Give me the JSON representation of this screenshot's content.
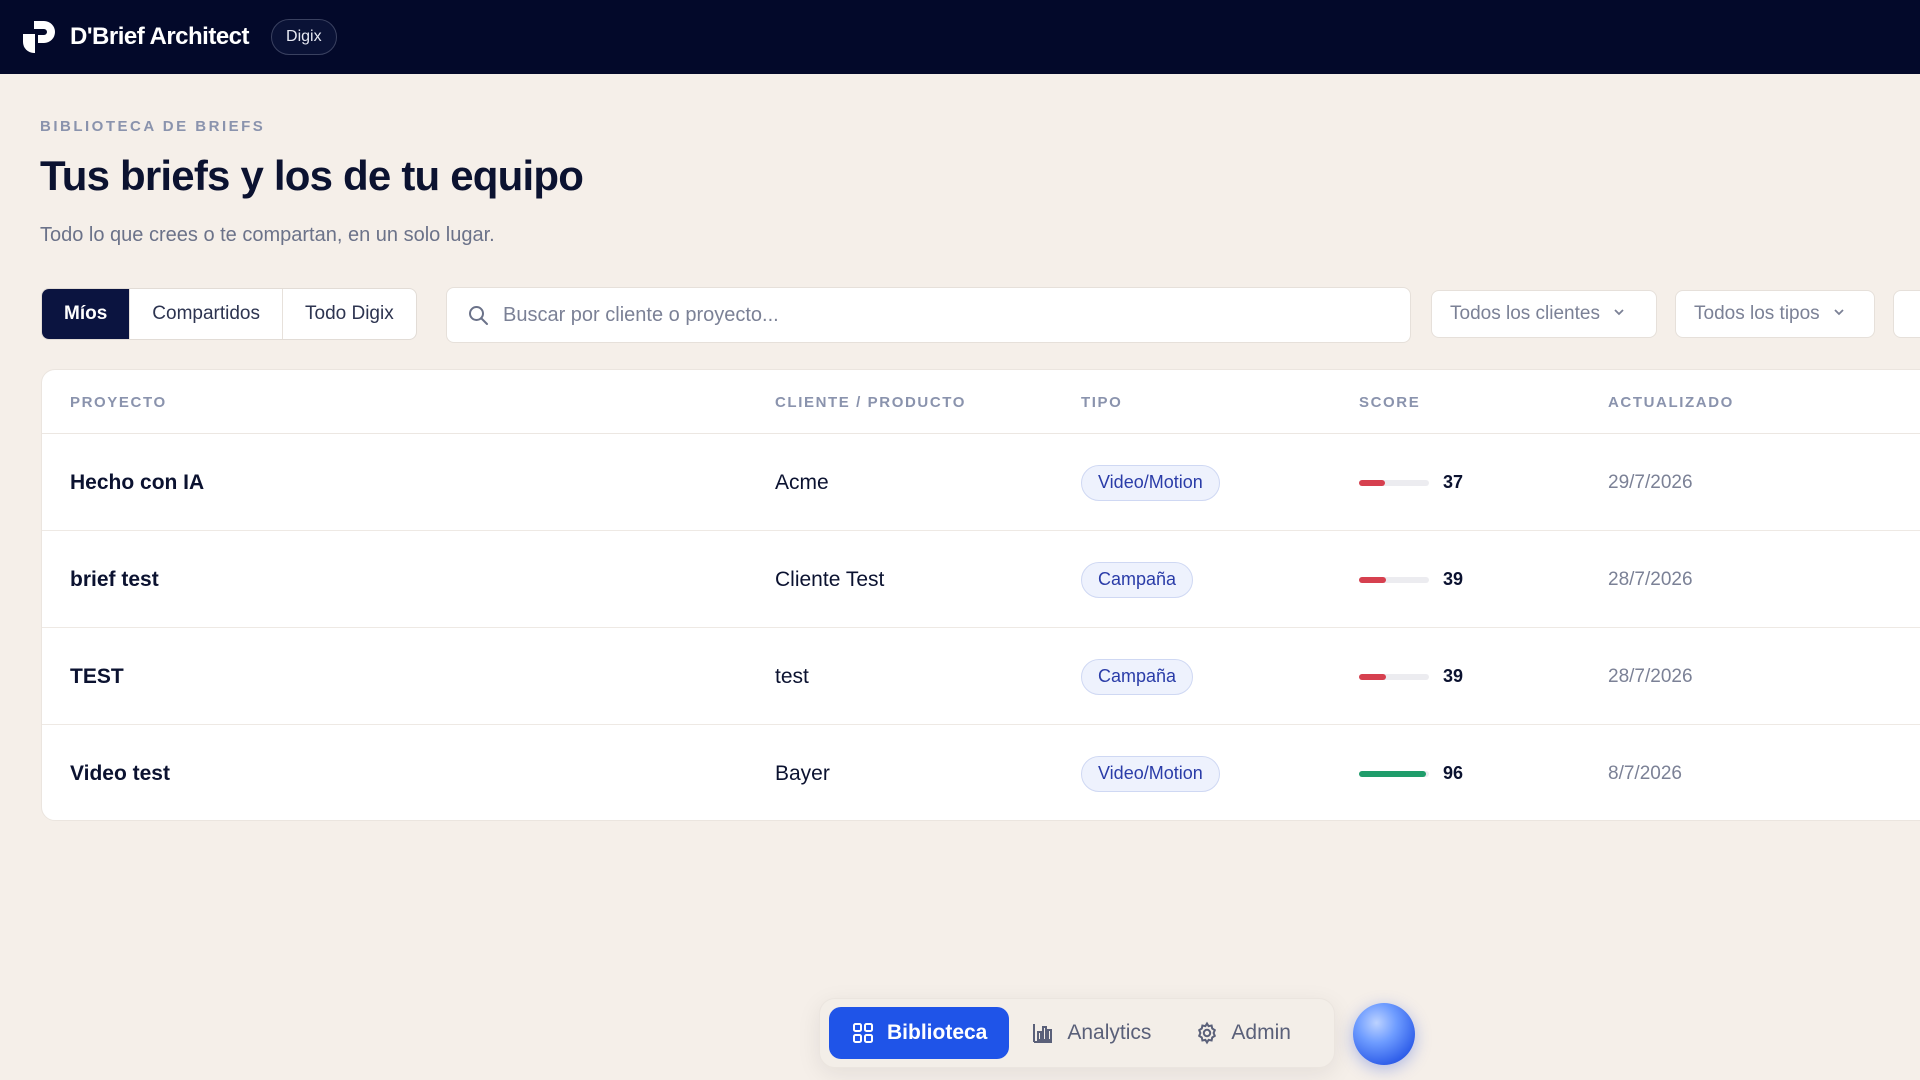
{
  "app": {
    "brand": "D'Brief Architect",
    "org_badge": "Digix"
  },
  "header": {
    "eyebrow": "BIBLIOTECA DE BRIEFS",
    "title": "Tus briefs y los de tu equipo",
    "subtitle": "Todo lo que crees o te compartan, en un solo lugar."
  },
  "filters": {
    "tabs": [
      {
        "label": "Míos",
        "active": true
      },
      {
        "label": "Compartidos",
        "active": false
      },
      {
        "label": "Todo Digix",
        "active": false
      }
    ],
    "search_placeholder": "Buscar por cliente o proyecto...",
    "clients_dropdown": "Todos los clientes",
    "types_dropdown": "Todos los tipos"
  },
  "table": {
    "columns": [
      "PROYECTO",
      "CLIENTE / PRODUCTO",
      "TIPO",
      "SCORE",
      "ACTUALIZADO"
    ],
    "rows": [
      {
        "project": "Hecho con IA",
        "client": "Acme",
        "type": "Video/Motion",
        "score": 37,
        "updated": "29/7/2026"
      },
      {
        "project": "brief test",
        "client": "Cliente Test",
        "type": "Campaña",
        "score": 39,
        "updated": "28/7/2026"
      },
      {
        "project": "TEST",
        "client": "test",
        "type": "Campaña",
        "score": 39,
        "updated": "28/7/2026"
      },
      {
        "project": "Video test",
        "client": "Bayer",
        "type": "Video/Motion",
        "score": 96,
        "updated": "8/7/2026"
      }
    ]
  },
  "dock": {
    "items": [
      {
        "label": "Biblioteca",
        "icon": "grid-icon",
        "active": true
      },
      {
        "label": "Analytics",
        "icon": "bar-chart-icon",
        "active": false
      },
      {
        "label": "Admin",
        "icon": "gear-icon",
        "active": false
      }
    ]
  },
  "colors": {
    "topbar": "#03092a",
    "accent": "#1f54e8",
    "score_low": "#d6404f",
    "score_high": "#1f9d6b"
  }
}
